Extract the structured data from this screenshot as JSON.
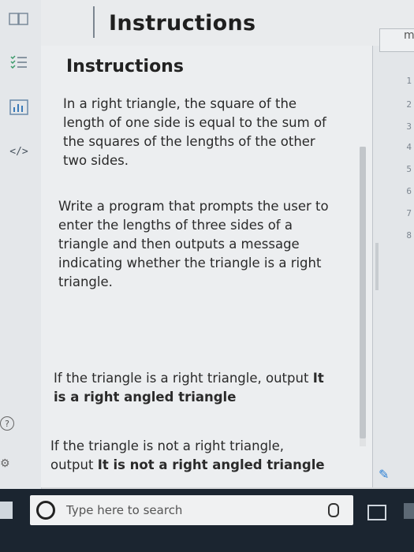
{
  "header": {
    "title": "Instructions"
  },
  "panel": {
    "title": "Instructions",
    "paragraphs": {
      "p1": "In a right triangle, the square of the length of one side is equal to the sum of the squares of the lengths of the other two sides.",
      "p2": "Write a program that prompts the user to enter the lengths of three sides of a triangle and then outputs a message indicating whether the triangle is a right triangle.",
      "p3_text": "If the triangle is a right triangle, output",
      "p3_bold": "It is a right angled triangle",
      "p4_text": "If the triangle is not a right triangle, output",
      "p4_bold": "It is not a right angled triangle"
    }
  },
  "editor": {
    "tab_label": "m",
    "line_numbers": [
      "1",
      "2",
      "3",
      "4",
      "5",
      "6",
      "7",
      "8"
    ]
  },
  "rail": {
    "icons": [
      "book-icon",
      "checklist-icon",
      "chart-icon",
      "code-icon",
      "help-icon",
      "settings-icon"
    ],
    "code_glyph": "</>",
    "help_glyph": "?"
  },
  "taskbar": {
    "search_placeholder": "Type here to search"
  },
  "colors": {
    "background": "#d7d9db",
    "panel": "#eceef0",
    "taskbar": "#1b2530",
    "accent": "#2a7fd4"
  }
}
